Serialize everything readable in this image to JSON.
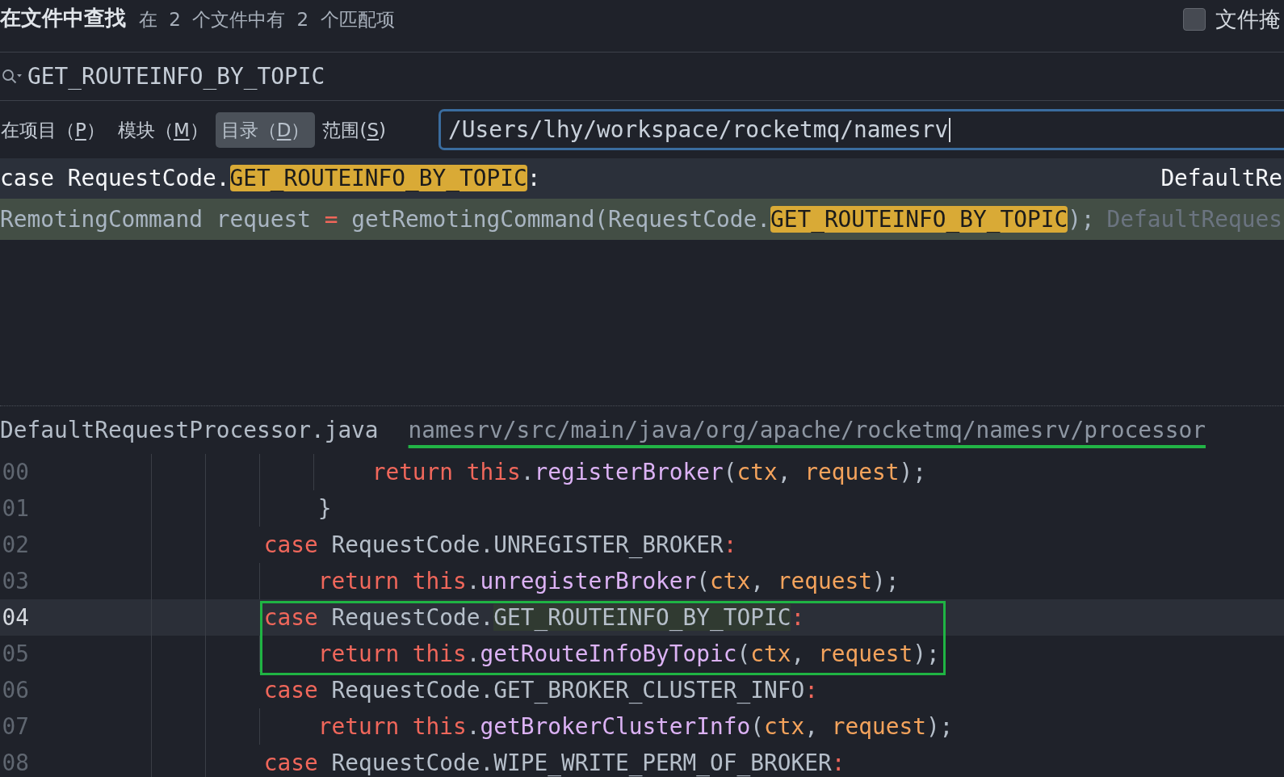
{
  "header": {
    "title": "在文件中查找",
    "summary": "在 2 个文件中有 2 个匹配项",
    "file_mask": {
      "label": "文件掩",
      "checked": false
    }
  },
  "search": {
    "value": "GET_ROUTEINFO_BY_TOPIC"
  },
  "scopes": [
    {
      "label_before": "在项目（",
      "mnemonic": "P",
      "label_after": "）",
      "selected": false
    },
    {
      "label_before": "模块（",
      "mnemonic": "M",
      "label_after": "）",
      "selected": false
    },
    {
      "label_before": "目录（",
      "mnemonic": "D",
      "label_after": "）",
      "selected": true
    },
    {
      "label_before": "范围(",
      "mnemonic": "S",
      "label_after": ")",
      "selected": false
    }
  ],
  "directory": {
    "value": "/Users/lhy/workspace/rocketmq/namesrv",
    "focused": true
  },
  "results": [
    {
      "selected": true,
      "tokens": [
        {
          "text": "case RequestCode.",
          "kind": "plain"
        },
        {
          "text": "GET_ROUTEINFO_BY_TOPIC",
          "kind": "match"
        },
        {
          "text": ":",
          "kind": "plain"
        }
      ],
      "file": "DefaultRe"
    },
    {
      "selected": false,
      "color": "#434e45",
      "tokens": [
        {
          "text": "RemotingCommand request ",
          "kind": "plain"
        },
        {
          "text": "=",
          "kind": "operator"
        },
        {
          "text": " getRemotingCommand(RequestCode.",
          "kind": "plain"
        },
        {
          "text": "GET_ROUTEINFO_BY_TOPIC",
          "kind": "match"
        },
        {
          "text": ");",
          "kind": "plain"
        }
      ],
      "file": "DefaultReques"
    }
  ],
  "preview": {
    "file_name": "DefaultRequestProcessor.java",
    "path": "namesrv/src/main/java/org/apache/rocketmq/namesrv/processor",
    "path_marked": true,
    "lines": [
      {
        "number": "00",
        "current": false,
        "boxed": false,
        "tokens": [
          {
            "text": "                        return ",
            "kind": "keyword"
          },
          {
            "text": "this",
            "kind": "keyword"
          },
          {
            "text": ".",
            "kind": "plain"
          },
          {
            "text": "registerBroker",
            "kind": "method"
          },
          {
            "text": "(",
            "kind": "plain"
          },
          {
            "text": "ctx",
            "kind": "param"
          },
          {
            "text": ", ",
            "kind": "plain"
          },
          {
            "text": "request",
            "kind": "param"
          },
          {
            "text": ");",
            "kind": "plain"
          }
        ]
      },
      {
        "number": "01",
        "current": false,
        "boxed": false,
        "tokens": [
          {
            "text": "                    }",
            "kind": "plain"
          }
        ]
      },
      {
        "number": "02",
        "current": false,
        "boxed": false,
        "tokens": [
          {
            "text": "                case",
            "kind": "keyword"
          },
          {
            "text": " RequestCode.UNREGISTER_BROKER",
            "kind": "plain"
          },
          {
            "text": ":",
            "kind": "operator"
          }
        ]
      },
      {
        "number": "03",
        "current": false,
        "boxed": false,
        "tokens": [
          {
            "text": "                    return ",
            "kind": "keyword"
          },
          {
            "text": "this",
            "kind": "keyword"
          },
          {
            "text": ".",
            "kind": "plain"
          },
          {
            "text": "unregisterBroker",
            "kind": "method"
          },
          {
            "text": "(",
            "kind": "plain"
          },
          {
            "text": "ctx",
            "kind": "param"
          },
          {
            "text": ", ",
            "kind": "plain"
          },
          {
            "text": "request",
            "kind": "param"
          },
          {
            "text": ");",
            "kind": "plain"
          }
        ]
      },
      {
        "number": "04",
        "current": true,
        "boxed": true,
        "tokens": [
          {
            "text": "                case",
            "kind": "keyword"
          },
          {
            "text": " RequestCode.",
            "kind": "plain"
          },
          {
            "text": "GET_ROUTEINFO_BY_TOPIC",
            "kind": "match"
          },
          {
            "text": ":",
            "kind": "operator"
          }
        ]
      },
      {
        "number": "05",
        "current": false,
        "boxed": true,
        "tokens": [
          {
            "text": "                    return ",
            "kind": "keyword"
          },
          {
            "text": "this",
            "kind": "keyword"
          },
          {
            "text": ".",
            "kind": "plain"
          },
          {
            "text": "getRouteInfoByTopic",
            "kind": "method"
          },
          {
            "text": "(",
            "kind": "plain"
          },
          {
            "text": "ctx",
            "kind": "param"
          },
          {
            "text": ", ",
            "kind": "plain"
          },
          {
            "text": "request",
            "kind": "param"
          },
          {
            "text": ");",
            "kind": "plain"
          }
        ]
      },
      {
        "number": "06",
        "current": false,
        "boxed": false,
        "tokens": [
          {
            "text": "                case",
            "kind": "keyword"
          },
          {
            "text": " RequestCode.GET_BROKER_CLUSTER_INFO",
            "kind": "plain"
          },
          {
            "text": ":",
            "kind": "operator"
          }
        ]
      },
      {
        "number": "07",
        "current": false,
        "boxed": false,
        "tokens": [
          {
            "text": "                    return ",
            "kind": "keyword"
          },
          {
            "text": "this",
            "kind": "keyword"
          },
          {
            "text": ".",
            "kind": "plain"
          },
          {
            "text": "getBrokerClusterInfo",
            "kind": "method"
          },
          {
            "text": "(",
            "kind": "plain"
          },
          {
            "text": "ctx",
            "kind": "param"
          },
          {
            "text": ", ",
            "kind": "plain"
          },
          {
            "text": "request",
            "kind": "param"
          },
          {
            "text": ");",
            "kind": "plain"
          }
        ]
      },
      {
        "number": "08",
        "current": false,
        "boxed": false,
        "tokens": [
          {
            "text": "                case",
            "kind": "keyword"
          },
          {
            "text": " RequestCode.WIPE_WRITE_PERM_OF_BROKER",
            "kind": "plain"
          },
          {
            "text": ":",
            "kind": "operator"
          }
        ]
      }
    ]
  }
}
